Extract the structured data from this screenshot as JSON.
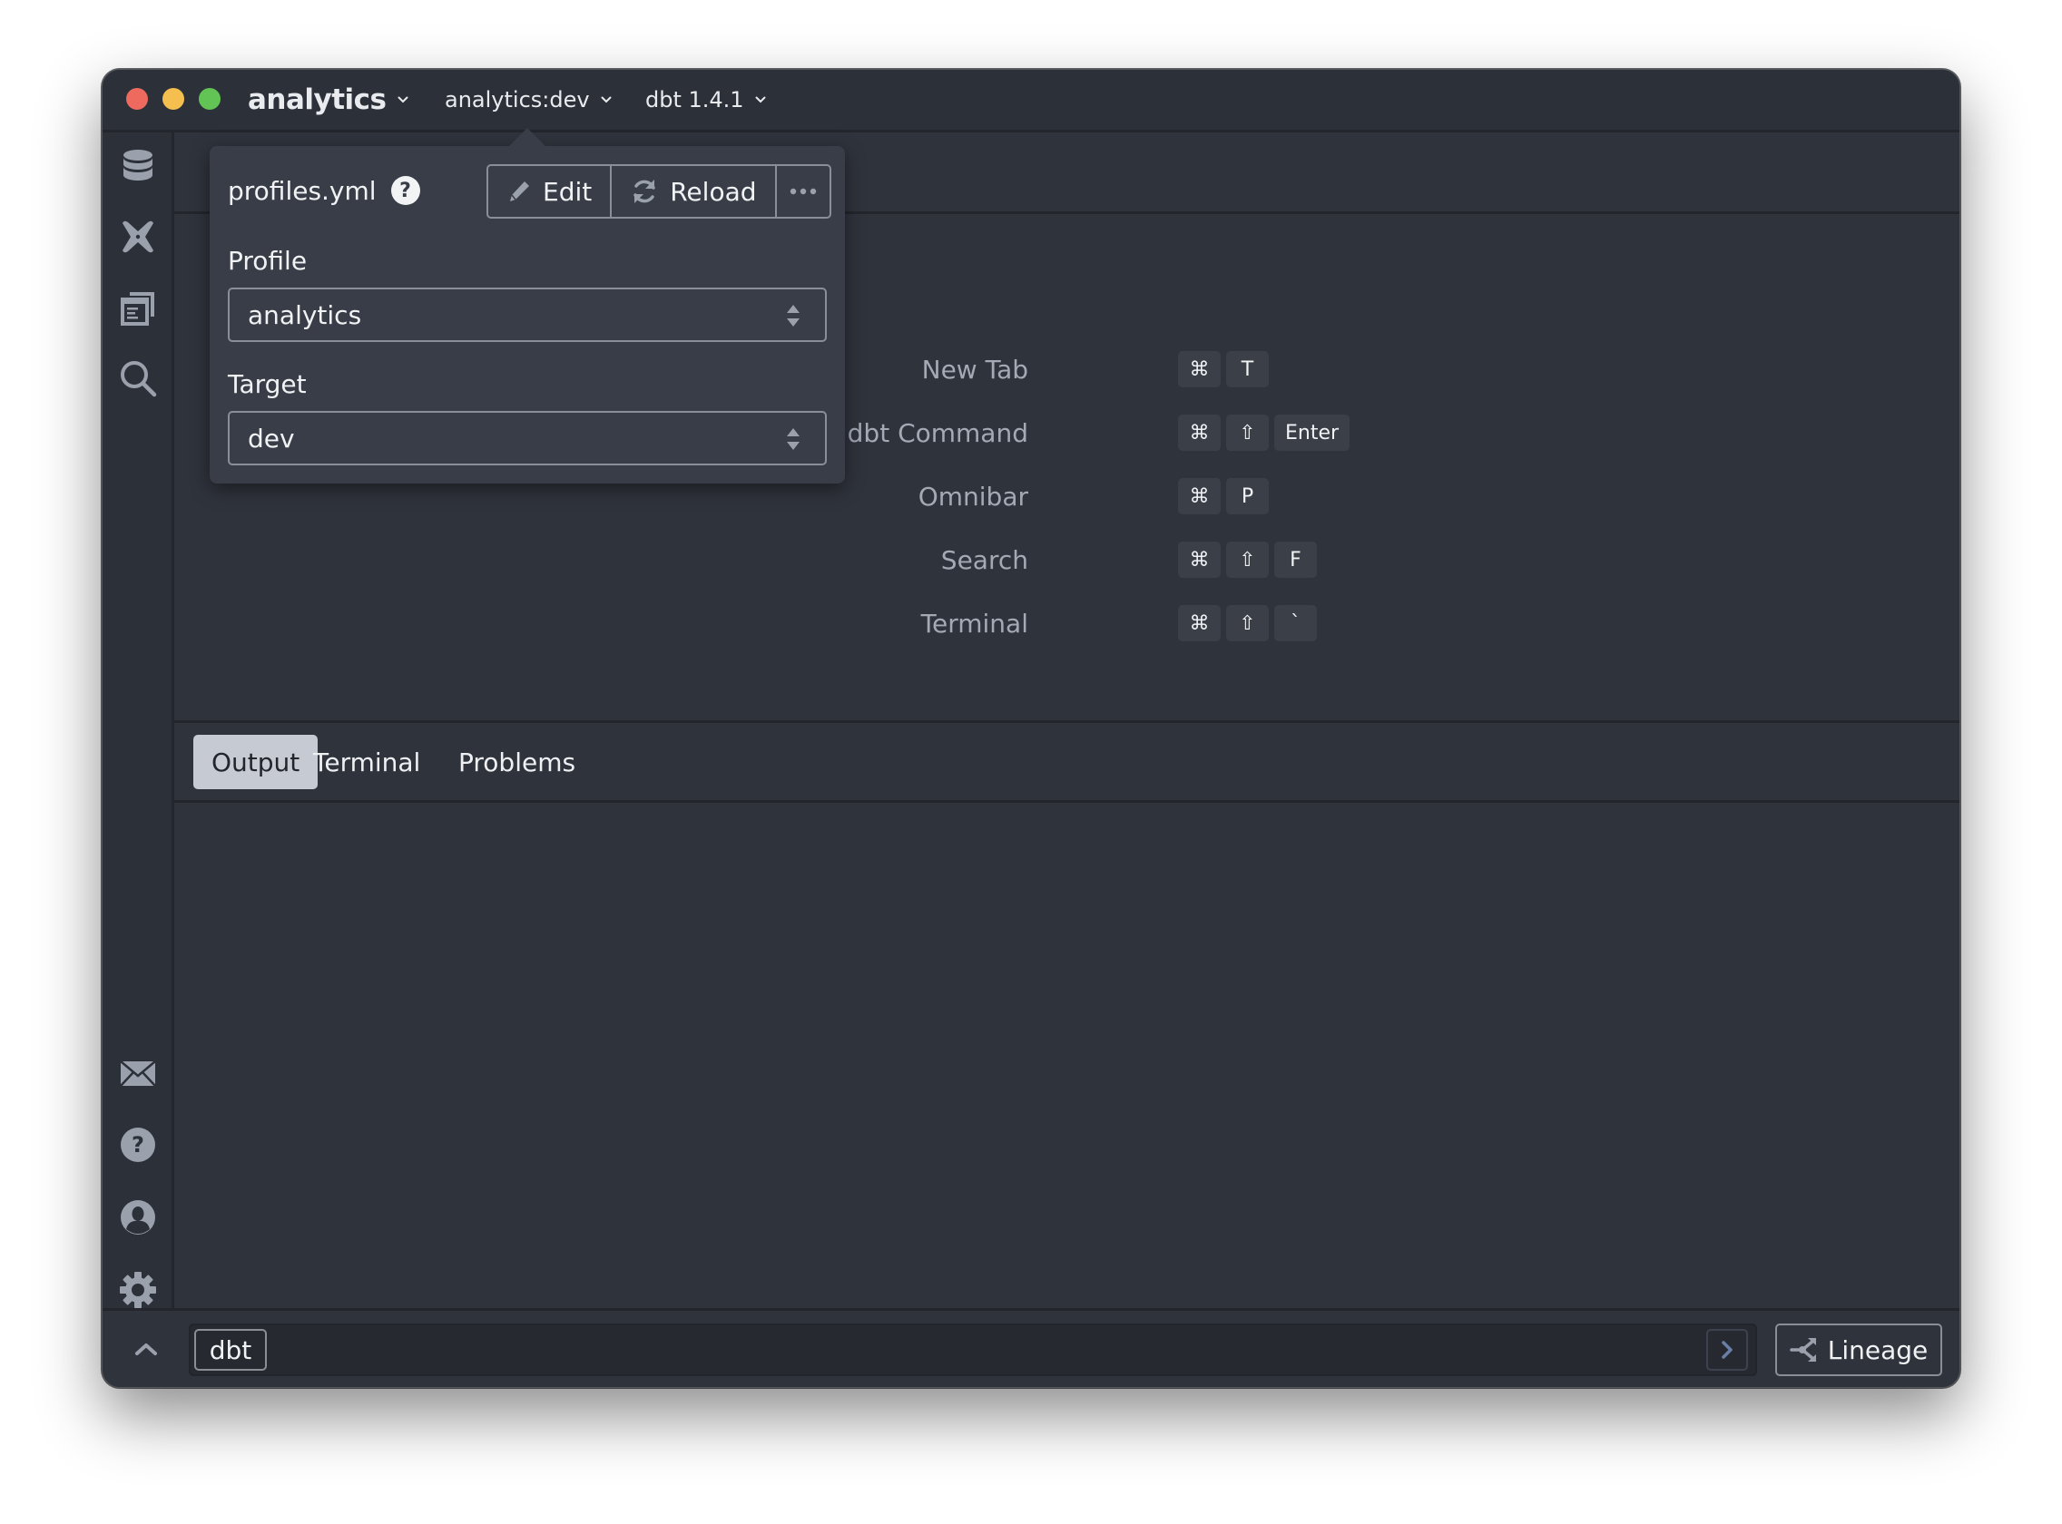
{
  "titlebar": {
    "project": "analytics",
    "environment": "analytics:dev",
    "dbt_version": "dbt 1.4.1"
  },
  "sidebar": {
    "top_items": [
      {
        "name": "database",
        "icon": "database-icon"
      },
      {
        "name": "dbt",
        "icon": "dbt-logo-icon"
      },
      {
        "name": "tabs",
        "icon": "windows-icon"
      },
      {
        "name": "search",
        "icon": "search-icon"
      }
    ],
    "bottom_items": [
      {
        "name": "feedback",
        "icon": "mail-icon"
      },
      {
        "name": "help",
        "icon": "help-icon"
      },
      {
        "name": "account",
        "icon": "user-icon"
      },
      {
        "name": "settings",
        "icon": "gear-icon"
      }
    ]
  },
  "shortcuts": [
    {
      "label": "New Tab",
      "keys": [
        "⌘",
        "T"
      ]
    },
    {
      "label": "Input dbt Command",
      "keys": [
        "⌘",
        "⇧",
        "Enter"
      ]
    },
    {
      "label": "Omnibar",
      "keys": [
        "⌘",
        "P"
      ]
    },
    {
      "label": "Search",
      "keys": [
        "⌘",
        "⇧",
        "F"
      ]
    },
    {
      "label": "Terminal",
      "keys": [
        "⌘",
        "⇧",
        "`"
      ]
    }
  ],
  "panel": {
    "tabs": [
      {
        "label": "Output",
        "active": true
      },
      {
        "label": "Terminal",
        "active": false
      },
      {
        "label": "Problems",
        "active": false
      }
    ]
  },
  "command_bar": {
    "prefix": "dbt",
    "value": "",
    "lineage_label": "Lineage"
  },
  "popover": {
    "title": "profiles.yml",
    "edit_label": "Edit",
    "reload_label": "Reload",
    "profile_label": "Profile",
    "profile_value": "analytics",
    "target_label": "Target",
    "target_value": "dev"
  },
  "colors": {
    "background": "#2f333c",
    "popover": "#393d47",
    "icon": "#9aa0ac",
    "run_chevron": "#6a7fa8"
  }
}
